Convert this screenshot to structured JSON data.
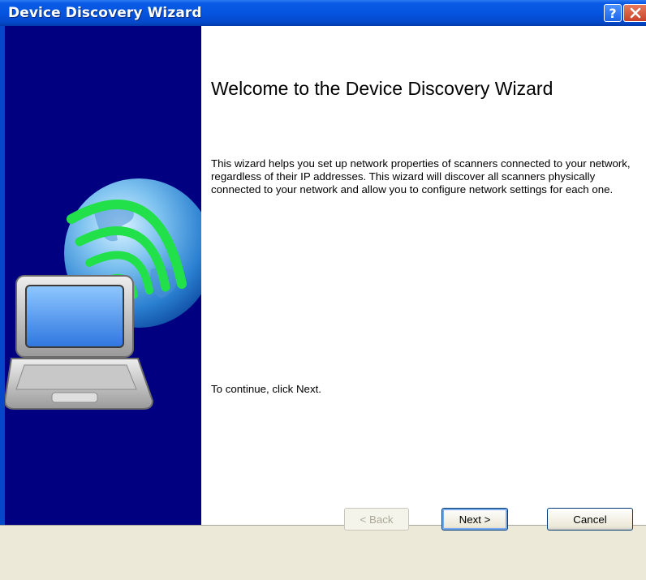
{
  "window": {
    "title": "Device Discovery Wizard"
  },
  "titlebar": {
    "help_label": "?",
    "close_icon": "close-icon"
  },
  "illustration": {
    "icon": "laptop-globe-wireless-icon"
  },
  "content": {
    "heading": "Welcome to the Device Discovery Wizard",
    "description": "This wizard helps you set up network properties of scanners connected to your network, regardless of their IP addresses. This wizard will discover all scanners physically connected to your network and allow you to configure network settings for each one.",
    "continue_text": "To continue, click Next."
  },
  "buttons": {
    "back": "< Back",
    "next": "Next >",
    "cancel": "Cancel"
  },
  "colors": {
    "titlebar": "#0555e0",
    "sidebar": "#000080",
    "wireless": "#22e04a"
  }
}
